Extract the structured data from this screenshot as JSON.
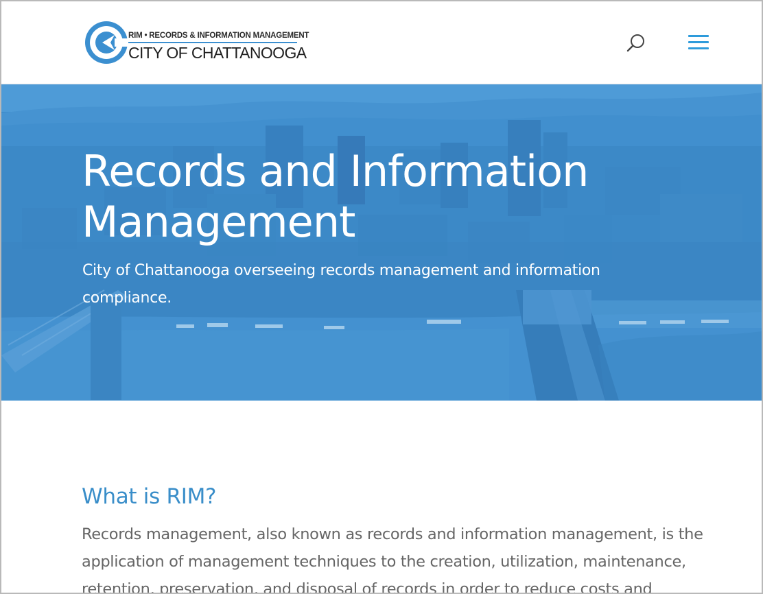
{
  "header": {
    "logo": {
      "tagline": "RIM • RECORDS & INFORMATION MANAGEMENT",
      "name": "CITY OF CHATTANOOGA"
    },
    "search_icon": "search-icon",
    "menu_icon": "hamburger-menu-icon"
  },
  "hero": {
    "title": "Records and Information Management",
    "subtitle": "City of Chattanooga overseeing records management and information compliance.",
    "overlay_color": "#3a8fd0"
  },
  "main": {
    "heading": "What is RIM?",
    "body": "Records management, also known as records and information management, is the application of management techniques to the creation, utilization, maintenance, retention, preservation, and disposal of records in order to reduce costs and"
  },
  "colors": {
    "accent": "#2e9bdb",
    "heading": "#3a8ec9",
    "body_text": "#666666"
  }
}
